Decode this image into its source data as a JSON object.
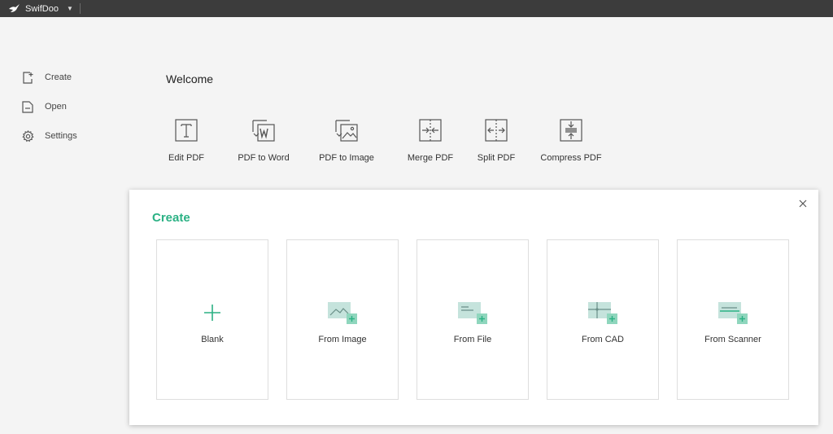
{
  "app": {
    "name": "SwifDoo",
    "dropdown_icon": "caret-down-icon",
    "logo_icon": "swallow-logo-icon"
  },
  "sidebar": {
    "items": [
      {
        "label": "Create",
        "icon": "new-document-icon"
      },
      {
        "label": "Open",
        "icon": "open-document-icon"
      },
      {
        "label": "Settings",
        "icon": "gear-icon"
      }
    ]
  },
  "welcome": {
    "title": "Welcome",
    "tools": [
      {
        "label": "Edit PDF",
        "icon": "text-edit-icon"
      },
      {
        "label": "PDF to Word",
        "icon": "pdf-to-word-icon"
      },
      {
        "label": "PDF to Image",
        "icon": "pdf-to-image-icon"
      },
      {
        "label": "Merge PDF",
        "icon": "merge-icon"
      },
      {
        "label": "Split PDF",
        "icon": "split-icon"
      },
      {
        "label": "Compress PDF",
        "icon": "compress-icon"
      }
    ]
  },
  "create_dialog": {
    "title": "Create",
    "close_icon": "close-icon",
    "options": [
      {
        "label": "Blank",
        "icon": "plus-icon"
      },
      {
        "label": "From Image",
        "icon": "image-add-icon"
      },
      {
        "label": "From File",
        "icon": "file-add-icon"
      },
      {
        "label": "From CAD",
        "icon": "cad-add-icon"
      },
      {
        "label": "From Scanner",
        "icon": "scanner-add-icon"
      }
    ]
  },
  "colors": {
    "accent": "#2bb184",
    "titlebar": "#3c3c3c",
    "background": "#f4f4f4",
    "icon_tint": "#c5e3dc"
  }
}
